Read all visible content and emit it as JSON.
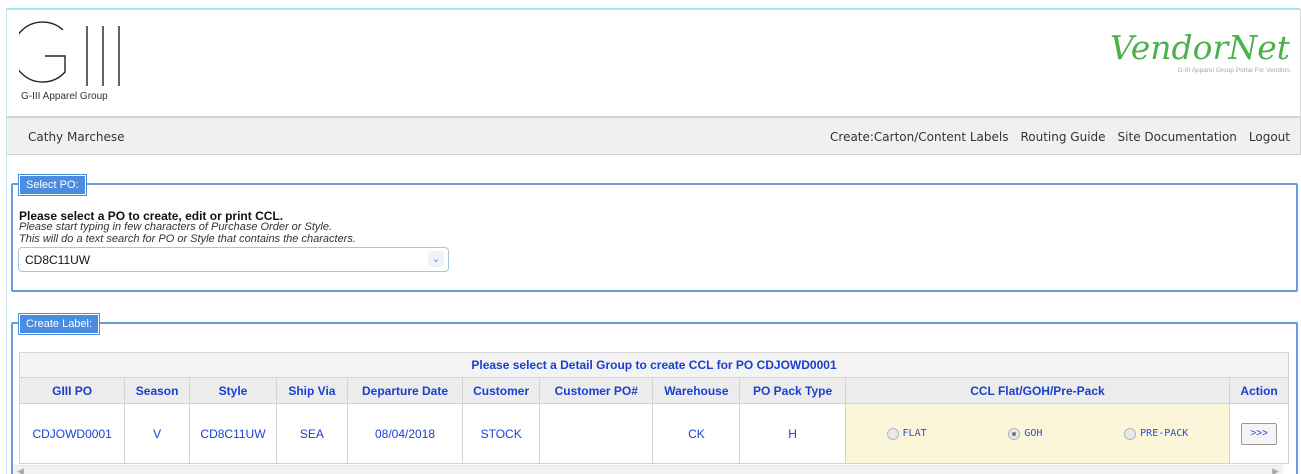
{
  "header": {
    "logo_text": "GIII",
    "logo_sub": "G-III Apparel Group",
    "brand_title": "VendorNet",
    "brand_sub": "G-III Apparel Group Portal For Vendors"
  },
  "navbar": {
    "user": "Cathy Marchese",
    "links": [
      "Create:Carton/Content Labels",
      "Routing Guide",
      "Site Documentation",
      "Logout"
    ]
  },
  "select_po": {
    "legend": "Select PO:",
    "heading": "Please select a PO to create, edit or print CCL.",
    "help1": "Please start typing in few characters of Purchase Order or Style.",
    "help2": "This will do a text search for PO or Style that contains the characters.",
    "value": "CD8C11UW",
    "chevron_icon": "chevron-down-icon"
  },
  "create_label": {
    "legend": "Create Label:",
    "caption": "Please select a Detail Group to create CCL for PO CDJOWD0001",
    "columns": [
      "GIII PO",
      "Season",
      "Style",
      "Ship Via",
      "Departure Date",
      "Customer",
      "Customer PO#",
      "Warehouse",
      "PO Pack Type",
      "CCL Flat/GOH/Pre-Pack",
      "Action"
    ],
    "row": {
      "giii_po": "CDJOWD0001",
      "season": "V",
      "style": "CD8C11UW",
      "ship_via": "SEA",
      "departure_date": "08/04/2018",
      "customer": "STOCK",
      "customer_po": "",
      "warehouse": "CK",
      "po_pack_type": "H",
      "ccl_options": [
        "FLAT",
        "GOH",
        "PRE-PACK"
      ],
      "ccl_selected": "GOH",
      "action_label": ">>>"
    }
  },
  "colors": {
    "brand_green": "#4cb04c",
    "link_blue": "#1a3fcf",
    "legend_blue": "#4a8de0",
    "ccl_bg": "#fbf6d9"
  }
}
